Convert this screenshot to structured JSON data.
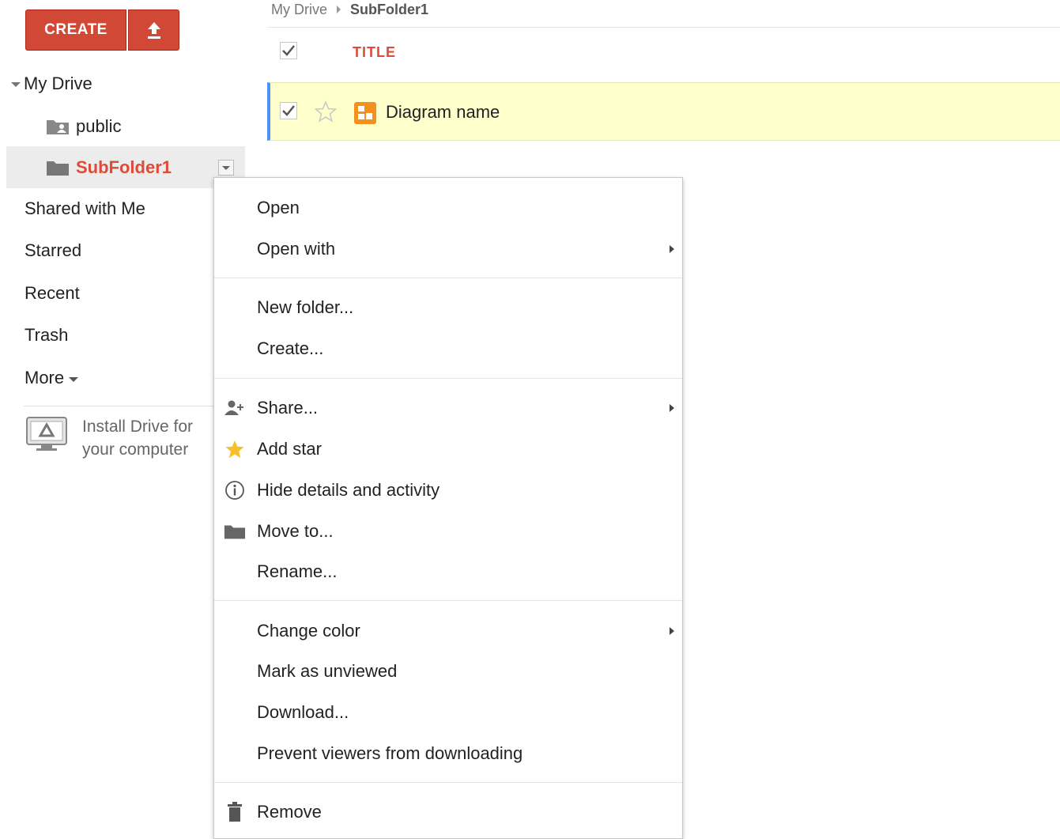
{
  "toolbar": {
    "create_label": "CREATE",
    "upload_icon": "upload-arrow-icon"
  },
  "sidebar": {
    "my_drive": "My Drive",
    "folders": [
      {
        "label": "public",
        "icon": "shared-folder-icon"
      },
      {
        "label": "SubFolder1",
        "icon": "folder-icon",
        "selected": true
      }
    ],
    "items": [
      {
        "label": "Shared with Me"
      },
      {
        "label": "Starred"
      },
      {
        "label": "Recent"
      },
      {
        "label": "Trash"
      },
      {
        "label": "More"
      }
    ],
    "install": {
      "line1": "Install Drive for",
      "line2": "your computer",
      "icon": "drive-monitor-icon"
    }
  },
  "breadcrumb": {
    "root": "My Drive",
    "current": "SubFolder1"
  },
  "list": {
    "column_title": "TITLE",
    "rows": [
      {
        "name": "Diagram name",
        "checked": true,
        "starred": false,
        "icon": "drawing-icon"
      }
    ]
  },
  "context_menu": {
    "items": [
      {
        "label": "Open"
      },
      {
        "label": "Open with",
        "submenu": true
      },
      {
        "label": "New folder..."
      },
      {
        "label": "Create..."
      },
      {
        "label": "Share...",
        "icon": "share-person-icon",
        "submenu": true
      },
      {
        "label": "Add star",
        "icon": "star-icon"
      },
      {
        "label": "Hide details and activity",
        "icon": "info-icon"
      },
      {
        "label": "Move to...",
        "icon": "folder-icon"
      },
      {
        "label": "Rename..."
      },
      {
        "label": "Change color",
        "submenu": true
      },
      {
        "label": "Mark as unviewed"
      },
      {
        "label": "Download..."
      },
      {
        "label": "Prevent viewers from downloading"
      },
      {
        "label": "Remove",
        "icon": "trash-icon"
      }
    ]
  },
  "colors": {
    "accent_red": "#d14836",
    "selected_text": "#dd4b39",
    "row_highlight": "#ffffcc",
    "selection_bar": "#4d90fe",
    "star_gold": "#f7c028",
    "drawing_orange": "#f4901e"
  }
}
